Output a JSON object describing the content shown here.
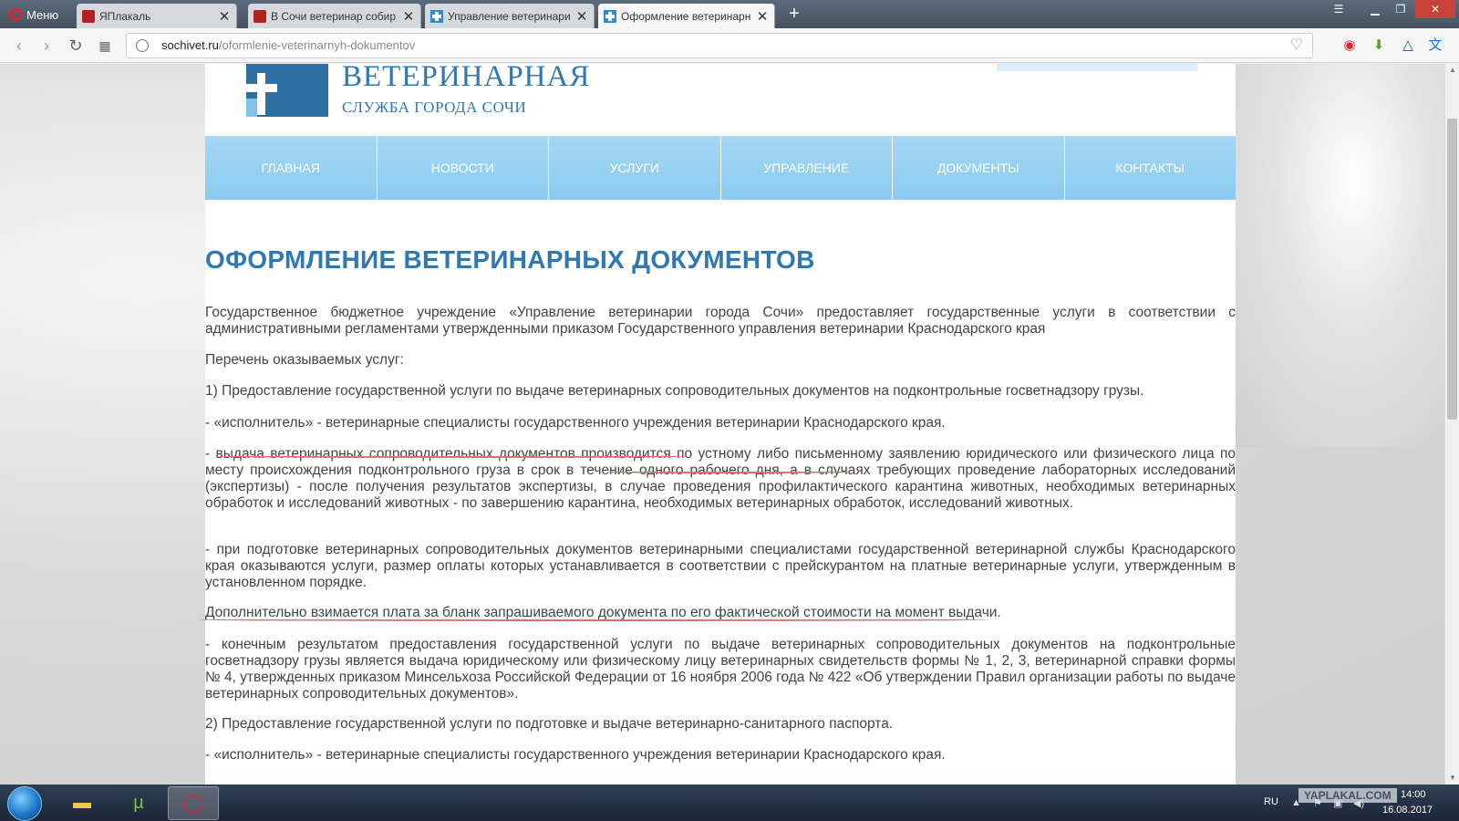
{
  "browser": {
    "menu_label": "Меню",
    "tabs": [
      {
        "title": "ЯПлакаль",
        "active": false
      },
      {
        "title": "В Сочи ветеринар собир",
        "active": false
      },
      {
        "title": "Управление ветеринари",
        "active": false
      },
      {
        "title": "Оформление ветеринарн",
        "active": true
      }
    ],
    "new_tab_label": "+",
    "url_domain": "sochivet.ru",
    "url_path": "/oformlenie-veterinarnyh-dokumentov"
  },
  "site": {
    "title": "ВЕТЕРИНАРНАЯ",
    "subtitle": "СЛУЖБА ГОРОДА СОЧИ",
    "accent_color": "#2f78b3",
    "nav_color": "#9ad2f2",
    "nav": [
      "ГЛАВНАЯ",
      "НОВОСТИ",
      "УСЛУГИ",
      "УПРАВЛЕНИЕ",
      "ДОКУМЕНТЫ",
      "КОНТАКТЫ"
    ]
  },
  "article": {
    "title": "ОФОРМЛЕНИЕ ВЕТЕРИНАРНЫХ ДОКУМЕНТОВ",
    "paragraphs": [
      "Государственное бюджетное учреждение «Управление ветеринарии города Сочи» предоставляет государственные услуги в соответствии с административными регламентами утвержденными приказом Государственного управления ветеринарии Краснодарского края",
      "Перечень оказываемых услуг:",
      "1) Предоставление государственной услуги по выдаче ветеринарных сопроводительных документов на подконтрольные госветнадзору грузы.",
      "- «исполнитель» - ветеринарные специалисты государственного учреждения ветеринарии Краснодарского края.",
      "- выдача ветеринарных сопроводительных документов производится по устному либо письменному заявлению юридического или физического лица по месту происхождения подконтрольного груза в срок в течение одного рабочего дня, а в случаях требующих проведение лабораторных исследований (экспертизы) - после получения результатов экспертизы, в случае проведения профилактического карантина животных, необходимых ветеринарных обработок и исследований животных - по завершению карантина, необходимых ветеринарных обработок, исследований животных.",
      "- при подготовке ветеринарных сопроводительных документов ветеринарными специалистами государственной ветеринарной службы Краснодарского края оказываются услуги, размер оплаты которых устанавливается в соответствии с прейскурантом на платные ветеринарные услуги, утвержденным в установленном порядке.",
      "Дополнительно взимается плата за бланк запрашиваемого документа по его фактической стоимости на момент выдачи.",
      "- конечным результатом предоставления государственной услуги по выдаче ветеринарных сопроводительных документов на подконтрольные госветнадзору грузы является выдача юридическому или физическому лицу ветеринарных свидетельств формы № 1, 2, 3, ветеринарной справки формы № 4, утвержденных приказом Минсельхоза Российской Федерации от 16 ноября 2006 года № 422 «Об утверждении Правил организации работы по выдаче ветеринарных сопроводительных документов».",
      "2) Предоставление государственной услуги по подготовке и выдаче ветеринарно-санитарного паспорта.",
      "- «исполнитель» - ветеринарные специалисты государственного учреждения ветеринарии Краснодарского края."
    ]
  },
  "taskbar": {
    "language": "RU",
    "time": "14:00",
    "date": "16.08.2017",
    "watermark": "YAPLAKAL.COM"
  }
}
